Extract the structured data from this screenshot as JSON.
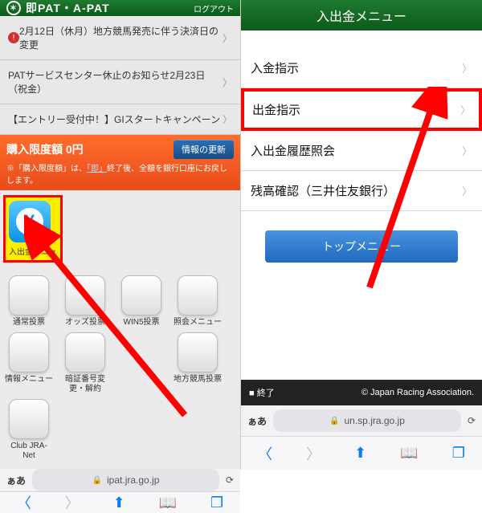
{
  "left": {
    "header": {
      "title": "即PAT・A-PAT",
      "logout": "ログアウト"
    },
    "notices": [
      {
        "text": "2月12日（休月）地方競馬発売に伴う決済日の変更",
        "warn": true
      },
      {
        "text": "PATサービスセンター休止のお知らせ2月23日（祝金）",
        "warn": false
      },
      {
        "text": "【エントリー受付中！】GIスタートキャンペーン",
        "warn": false
      }
    ],
    "limit": {
      "title": "購入限度額 0円",
      "button": "情報の更新",
      "note_a": "※「購入限度額」は、",
      "note_b": "「即」",
      "note_c": "終了後、全額を銀行口座にお戻しします。"
    },
    "bigIcon": {
      "label": "入出金メニュ"
    },
    "apps": [
      {
        "label": "通常投票",
        "cls": "ico-cards"
      },
      {
        "label": "オッズ投票",
        "cls": ""
      },
      {
        "label": "WIN5投票",
        "cls": ""
      },
      {
        "label": "照会メニュー",
        "cls": "ico-cards"
      },
      {
        "label": "情報メニュー",
        "cls": "ico-orange"
      },
      {
        "label": "暗証番号変更・解約",
        "cls": "ico-orange"
      },
      {
        "label": "",
        "cls": "hidden"
      },
      {
        "label": "地方競馬投票",
        "cls": "ico-cards"
      },
      {
        "label": "Club JRA-Net",
        "cls": ""
      }
    ],
    "url": "ipat.jra.go.jp",
    "aa": "ぁあ"
  },
  "right": {
    "header": "入出金メニュー",
    "menu": [
      {
        "label": "入金指示",
        "hl": false
      },
      {
        "label": "出金指示",
        "hl": true
      },
      {
        "label": "入出金履歴照会",
        "hl": false
      },
      {
        "label": "残高確認（三井住友銀行）",
        "hl": false
      }
    ],
    "topBtn": "トップメニュー",
    "footer": {
      "end": "■ 終了",
      "copy": "© Japan Racing Association."
    },
    "url": "un.sp.jra.go.jp",
    "aa": "ぁあ"
  }
}
